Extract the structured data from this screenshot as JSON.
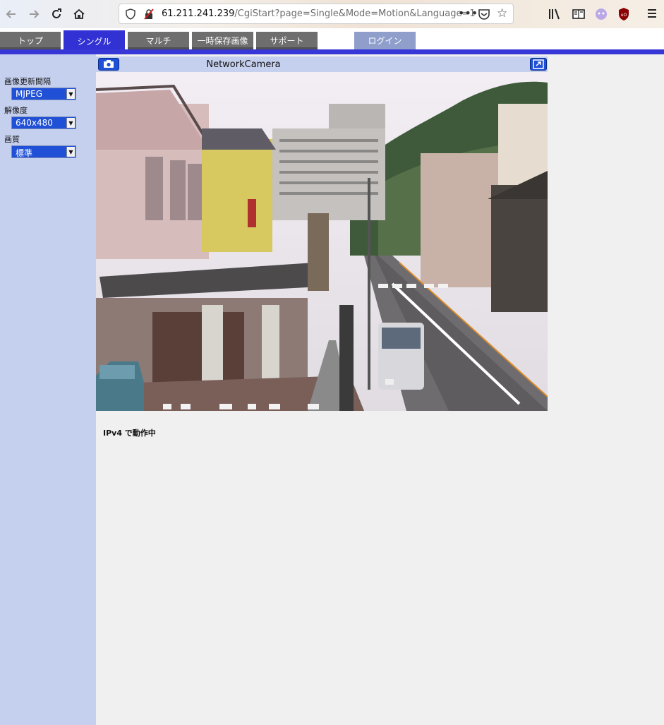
{
  "browser": {
    "url_host": "61.211.241.239",
    "url_path": "/CgiStart?page=Single&Mode=Motion&Language=1",
    "more_label": "•••"
  },
  "nav": {
    "tabs": [
      {
        "label": "トップ"
      },
      {
        "label": "シングル"
      },
      {
        "label": "マルチ"
      },
      {
        "label": "一時保存画像"
      },
      {
        "label": "サポート"
      }
    ],
    "login_label": "ログイン",
    "active_tab": "シングル",
    "accent_color": "#3131d4"
  },
  "sidebar": {
    "refresh": {
      "label": "画像更新間隔",
      "value": "MJPEG"
    },
    "resolution": {
      "label": "解像度",
      "value": "640x480"
    },
    "quality": {
      "label": "画質",
      "value": "標準"
    }
  },
  "camera": {
    "title": "NetworkCamera",
    "snapshot_icon": "camera-icon",
    "fullscreen_icon": "fullscreen-icon"
  },
  "status_text": "IPv4 で動作中"
}
